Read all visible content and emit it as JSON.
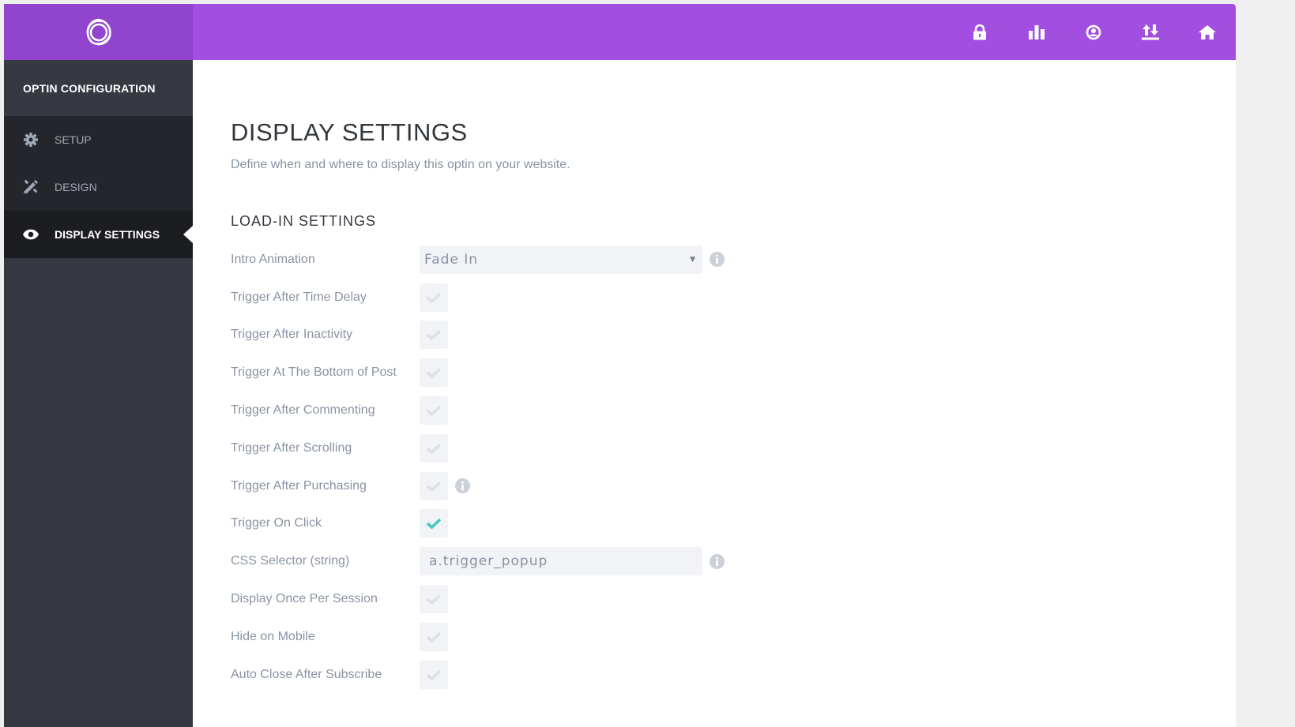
{
  "colors": {
    "brand_purple": "#a24fe1",
    "logo_purple": "#9145cf",
    "sidebar_bg": "#363842",
    "check_active": "#46c8c2",
    "check_inactive": "#dde0e6"
  },
  "topbar": {
    "logo_icon": "bloom-logo-icon",
    "icons": [
      "lock-icon",
      "bar-chart-icon",
      "account-icon",
      "import-export-icon",
      "home-icon"
    ]
  },
  "sidebar": {
    "header": "OPTIN CONFIGURATION",
    "items": [
      {
        "label": "SETUP",
        "icon": "gear-icon",
        "active": false
      },
      {
        "label": "DESIGN",
        "icon": "design-tools-icon",
        "active": false
      },
      {
        "label": "DISPLAY SETTINGS",
        "icon": "eye-icon",
        "active": true
      }
    ]
  },
  "main": {
    "title": "DISPLAY SETTINGS",
    "description": "Define when and where to display this optin on your website.",
    "section_title": "LOAD-IN SETTINGS",
    "fields": [
      {
        "label": "Intro Animation",
        "type": "select",
        "value": "Fade In",
        "info": true
      },
      {
        "label": "Trigger After Time Delay",
        "type": "checkbox",
        "checked": false
      },
      {
        "label": "Trigger After Inactivity",
        "type": "checkbox",
        "checked": false
      },
      {
        "label": "Trigger At The Bottom of Post",
        "type": "checkbox",
        "checked": false
      },
      {
        "label": "Trigger After Commenting",
        "type": "checkbox",
        "checked": false
      },
      {
        "label": "Trigger After Scrolling",
        "type": "checkbox",
        "checked": false
      },
      {
        "label": "Trigger After Purchasing",
        "type": "checkbox",
        "checked": false,
        "info": true
      },
      {
        "label": "Trigger On Click",
        "type": "checkbox",
        "checked": true
      },
      {
        "label": "CSS Selector (string)",
        "type": "text",
        "value": "a.trigger_popup",
        "info": true
      },
      {
        "label": "Display Once Per Session",
        "type": "checkbox",
        "checked": false
      },
      {
        "label": "Hide on Mobile",
        "type": "checkbox",
        "checked": false
      },
      {
        "label": "Auto Close After Subscribe",
        "type": "checkbox",
        "checked": false
      }
    ]
  }
}
